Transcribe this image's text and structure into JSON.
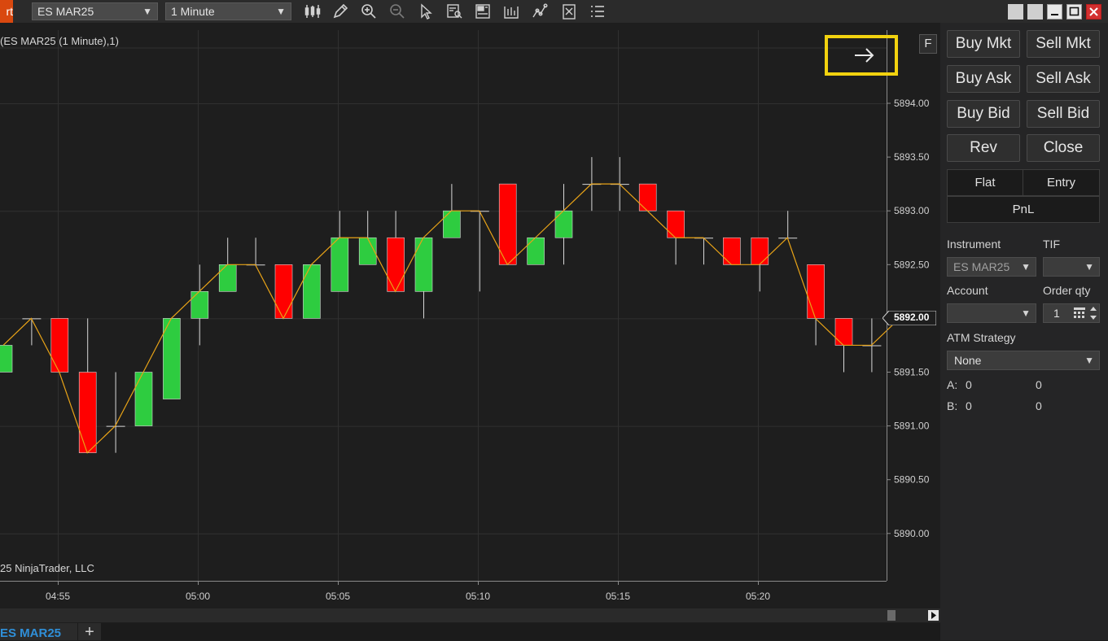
{
  "app_tab": "rt",
  "toolbar": {
    "instrument": "ES MAR25",
    "interval": "1 Minute"
  },
  "chart": {
    "label": "(ES MAR25 (1 Minute),1)",
    "copyright": "25 NinjaTrader, LLC",
    "f_button": "F",
    "current_price": "5892.00",
    "price_ticks": [
      "5894.00",
      "5893.50",
      "5893.00",
      "5892.50",
      "5892.00",
      "5891.50",
      "5891.00",
      "5890.50",
      "5890.00"
    ],
    "time_ticks": [
      "04:55",
      "05:00",
      "05:05",
      "05:10",
      "05:15",
      "05:20"
    ]
  },
  "chart_data": {
    "type": "candlestick",
    "ylim": [
      5889.75,
      5894.25
    ],
    "bars": [
      {
        "o": 5891.5,
        "h": 5891.75,
        "l": 5891.5,
        "c": 5891.75
      },
      {
        "o": 5892.0,
        "h": 5892.0,
        "l": 5891.75,
        "c": 5892.0
      },
      {
        "o": 5892.0,
        "h": 5892.0,
        "l": 5891.5,
        "c": 5891.5
      },
      {
        "o": 5891.5,
        "h": 5892.0,
        "l": 5890.75,
        "c": 5890.75
      },
      {
        "o": 5891.0,
        "h": 5891.5,
        "l": 5890.75,
        "c": 5891.0
      },
      {
        "o": 5891.0,
        "h": 5891.5,
        "l": 5891.0,
        "c": 5891.5
      },
      {
        "o": 5891.25,
        "h": 5892.0,
        "l": 5891.25,
        "c": 5892.0
      },
      {
        "o": 5892.0,
        "h": 5892.5,
        "l": 5891.75,
        "c": 5892.25
      },
      {
        "o": 5892.25,
        "h": 5892.75,
        "l": 5892.25,
        "c": 5892.5
      },
      {
        "o": 5892.5,
        "h": 5892.75,
        "l": 5892.5,
        "c": 5892.5
      },
      {
        "o": 5892.5,
        "h": 5892.5,
        "l": 5892.0,
        "c": 5892.0
      },
      {
        "o": 5892.0,
        "h": 5892.5,
        "l": 5892.0,
        "c": 5892.5
      },
      {
        "o": 5892.25,
        "h": 5893.0,
        "l": 5892.25,
        "c": 5892.75
      },
      {
        "o": 5892.5,
        "h": 5893.0,
        "l": 5892.5,
        "c": 5892.75
      },
      {
        "o": 5892.75,
        "h": 5893.0,
        "l": 5892.25,
        "c": 5892.25
      },
      {
        "o": 5892.25,
        "h": 5892.75,
        "l": 5892.0,
        "c": 5892.75
      },
      {
        "o": 5892.75,
        "h": 5893.25,
        "l": 5892.75,
        "c": 5893.0
      },
      {
        "o": 5893.0,
        "h": 5893.0,
        "l": 5892.25,
        "c": 5893.0
      },
      {
        "o": 5893.25,
        "h": 5893.25,
        "l": 5892.5,
        "c": 5892.5
      },
      {
        "o": 5892.5,
        "h": 5892.75,
        "l": 5892.5,
        "c": 5892.75
      },
      {
        "o": 5892.75,
        "h": 5893.25,
        "l": 5892.5,
        "c": 5893.0
      },
      {
        "o": 5893.25,
        "h": 5893.5,
        "l": 5893.0,
        "c": 5893.25
      },
      {
        "o": 5893.25,
        "h": 5893.5,
        "l": 5893.0,
        "c": 5893.25
      },
      {
        "o": 5893.25,
        "h": 5893.25,
        "l": 5893.0,
        "c": 5893.0
      },
      {
        "o": 5893.0,
        "h": 5893.0,
        "l": 5892.5,
        "c": 5892.75
      },
      {
        "o": 5892.75,
        "h": 5892.75,
        "l": 5892.5,
        "c": 5892.75
      },
      {
        "o": 5892.75,
        "h": 5892.75,
        "l": 5892.5,
        "c": 5892.5
      },
      {
        "o": 5892.75,
        "h": 5892.75,
        "l": 5892.25,
        "c": 5892.5
      },
      {
        "o": 5892.75,
        "h": 5893.0,
        "l": 5892.75,
        "c": 5892.75
      },
      {
        "o": 5892.5,
        "h": 5892.5,
        "l": 5891.75,
        "c": 5892.0
      },
      {
        "o": 5892.0,
        "h": 5892.0,
        "l": 5891.5,
        "c": 5891.75
      },
      {
        "o": 5891.75,
        "h": 5892.0,
        "l": 5891.5,
        "c": 5891.75
      },
      {
        "o": 5892.0,
        "h": 5892.0,
        "l": 5892.0,
        "c": 5892.0
      }
    ]
  },
  "panel": {
    "buy_mkt": "Buy Mkt",
    "sell_mkt": "Sell Mkt",
    "buy_ask": "Buy Ask",
    "sell_ask": "Sell Ask",
    "buy_bid": "Buy Bid",
    "sell_bid": "Sell Bid",
    "rev": "Rev",
    "close": "Close",
    "flat": "Flat",
    "entry": "Entry",
    "pnl": "PnL",
    "instrument_label": "Instrument",
    "instrument_value": "ES MAR25",
    "tif_label": "TIF",
    "account_label": "Account",
    "order_qty_label": "Order qty",
    "order_qty_value": "1",
    "atm_label": "ATM Strategy",
    "atm_value": "None",
    "a_label": "A:",
    "a_val1": "0",
    "a_val2": "0",
    "b_label": "B:",
    "b_val1": "0",
    "b_val2": "0"
  },
  "bottom": {
    "tab": "ES MAR25",
    "add": "+"
  },
  "colors": {
    "up": "#2ecc40",
    "down": "#ff0000",
    "line": "#e8a317",
    "highlight": "#f2d20f"
  }
}
